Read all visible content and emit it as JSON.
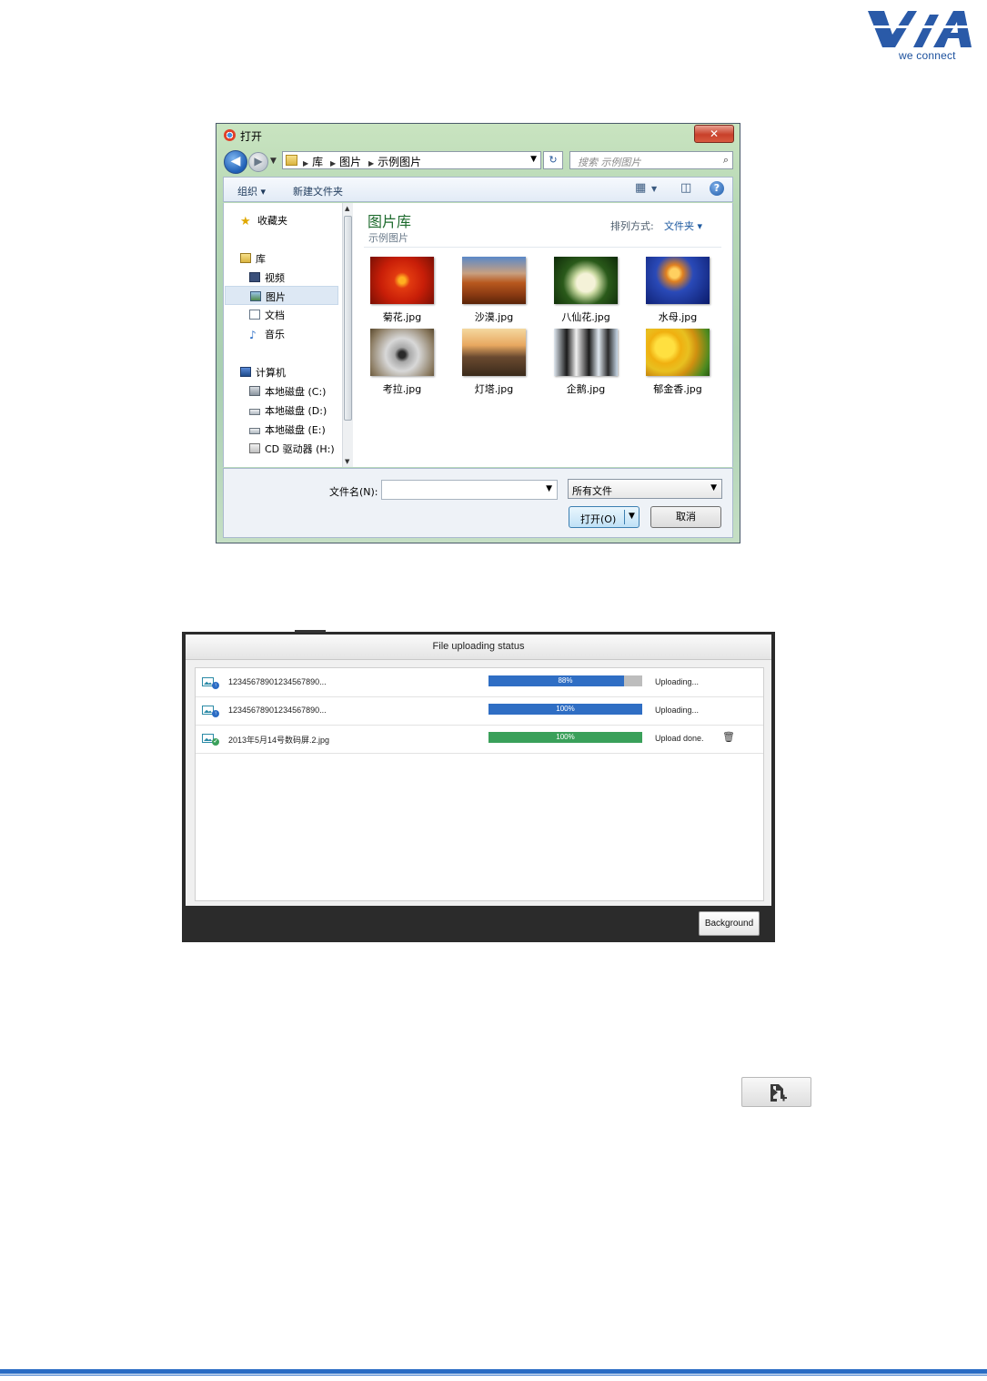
{
  "logo": {
    "text": "VIA",
    "tagline": "we connect",
    "color": "#2a5aa8"
  },
  "open_dialog": {
    "title": "打开",
    "address": {
      "crumbs": [
        "库",
        "图片",
        "示例图片"
      ]
    },
    "search_placeholder": "搜索 示例图片",
    "toolbar": {
      "organize": "组织 ▾",
      "new_folder": "新建文件夹"
    },
    "nav": {
      "favorites": "收藏夹",
      "libraries": "库",
      "lib_items": [
        "视频",
        "图片",
        "文档",
        "音乐"
      ],
      "computer": "计算机",
      "drives": [
        "本地磁盘 (C:)",
        "本地磁盘 (D:)",
        "本地磁盘 (E:)",
        "CD 驱动器 (H:)"
      ],
      "selected": "图片"
    },
    "content": {
      "title": "图片库",
      "subtitle": "示例图片",
      "sort_label": "排列方式:",
      "sort_value": "文件夹 ▾",
      "files": [
        "菊花.jpg",
        "沙漠.jpg",
        "八仙花.jpg",
        "水母.jpg",
        "考拉.jpg",
        "灯塔.jpg",
        "企鹅.jpg",
        "郁金香.jpg"
      ]
    },
    "footer": {
      "filename_label": "文件名(N):",
      "filename_value": "",
      "filetype": "所有文件",
      "open_button": "打开(O)",
      "cancel_button": "取消"
    }
  },
  "upload_dialog": {
    "title": "File uploading status",
    "rows": [
      {
        "name": "12345678901234567890...",
        "progress": 88,
        "progress_label": "88%",
        "status": "Uploading...",
        "state": "uploading",
        "bar_color": "#2f6ec4"
      },
      {
        "name": "12345678901234567890...",
        "progress": 100,
        "progress_label": "100%",
        "status": "Uploading...",
        "state": "uploading",
        "bar_color": "#2f6ec4"
      },
      {
        "name": "2013年5月14号数码屏.2.jpg",
        "progress": 100,
        "progress_label": "100%",
        "status": "Upload done.",
        "state": "done",
        "bar_color": "#3aa05a"
      }
    ],
    "background_button": "Background"
  },
  "add_file_button": {
    "icon": "add-file-icon"
  },
  "colors": {
    "accent_blue": "#2a6cc4",
    "progress_blue": "#2f6ec4",
    "progress_green": "#3aa05a",
    "dialog_dark": "#2b2b2b"
  }
}
